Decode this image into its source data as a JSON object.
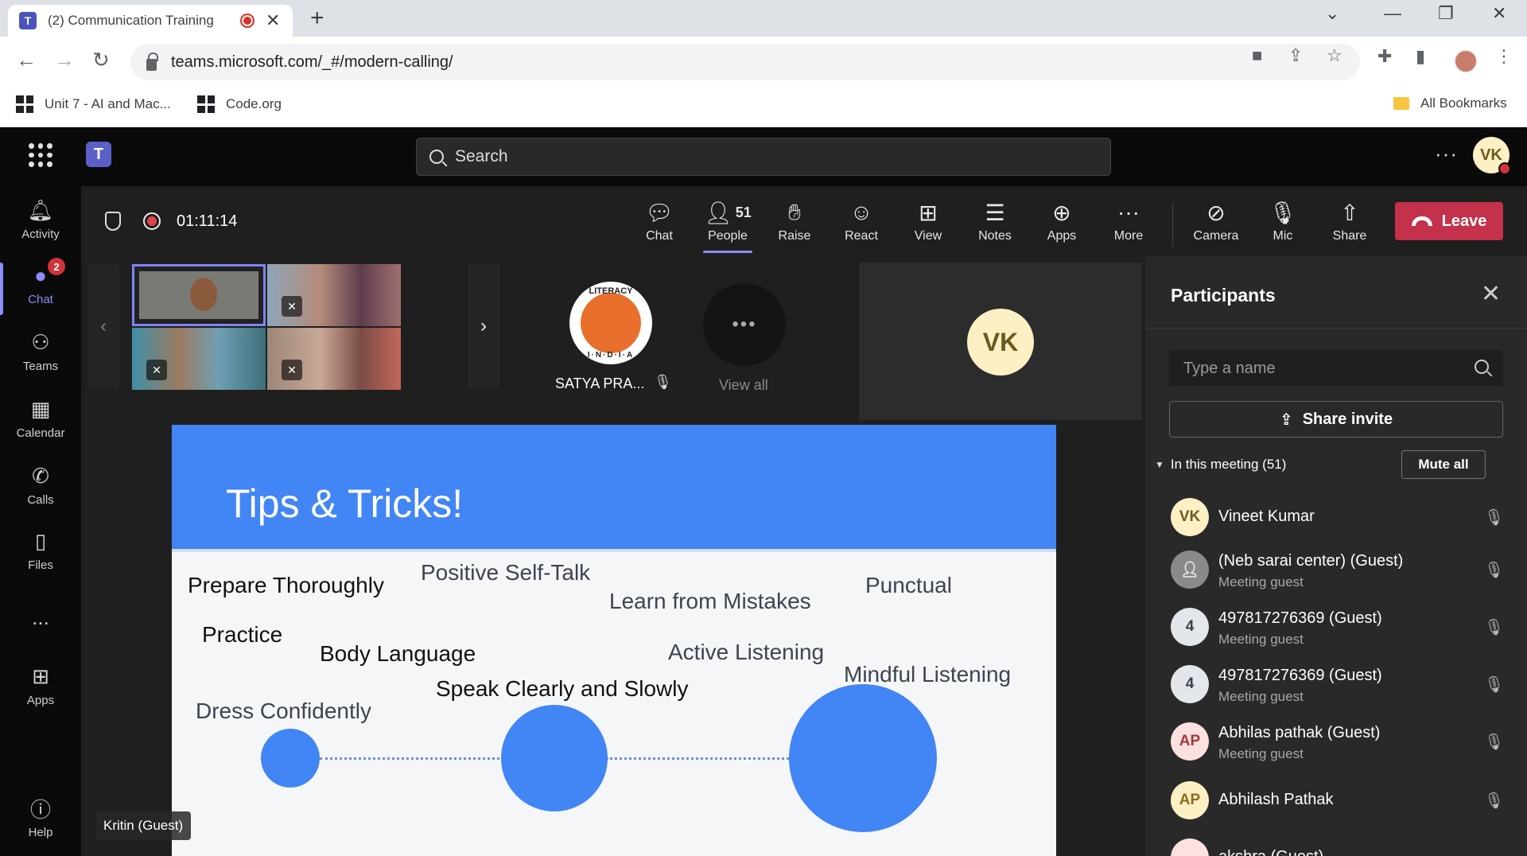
{
  "browser": {
    "tab_title": "(2) Communication Training",
    "url": "teams.microsoft.com/_#/modern-calling/",
    "bookmarks": [
      "Unit 7 - AI and Mac...",
      "Code.org"
    ],
    "all_bookmarks": "All Bookmarks"
  },
  "teams": {
    "search_placeholder": "Search",
    "me_initials": "VK"
  },
  "rail": [
    {
      "label": "Activity",
      "icon": "bell-icon"
    },
    {
      "label": "Chat",
      "icon": "chat-icon",
      "badge": "2",
      "active": true
    },
    {
      "label": "Teams",
      "icon": "teams-icon"
    },
    {
      "label": "Calendar",
      "icon": "calendar-icon"
    },
    {
      "label": "Calls",
      "icon": "phone-icon"
    },
    {
      "label": "Files",
      "icon": "file-icon"
    },
    {
      "label": "...",
      "icon": "more-icon"
    },
    {
      "label": "Apps",
      "icon": "apps-icon"
    },
    {
      "label": "Help",
      "icon": "help-icon"
    }
  ],
  "meeting": {
    "timer": "01:11:14",
    "toolbar": [
      {
        "label": "Chat",
        "icon": "chat-bubble-icon"
      },
      {
        "label": "People",
        "icon": "people-icon",
        "count": "51",
        "active": true
      },
      {
        "label": "Raise",
        "icon": "hand-icon"
      },
      {
        "label": "React",
        "icon": "smiley-icon"
      },
      {
        "label": "View",
        "icon": "grid-view-icon"
      },
      {
        "label": "Notes",
        "icon": "notes-icon"
      },
      {
        "label": "Apps",
        "icon": "add-app-icon"
      },
      {
        "label": "More",
        "icon": "more-icon"
      },
      {
        "label": "Camera",
        "icon": "camera-off-icon"
      },
      {
        "label": "Mic",
        "icon": "mic-off-icon"
      },
      {
        "label": "Share",
        "icon": "share-tray-icon"
      }
    ],
    "leave_label": "Leave",
    "gallery": {
      "satya_name": "SATYA PRA...",
      "satya_logo_top": "LITERACY",
      "satya_logo_bottom": "I·N·D·I·A",
      "view_all": "View all",
      "self_initials": "VK"
    },
    "name_chip": "Kritin (Guest)"
  },
  "slide": {
    "title": "Tips & Tricks!",
    "words": [
      "Prepare Thoroughly",
      "Positive Self-Talk",
      "Learn from Mistakes",
      "Punctual",
      "Practice",
      "Body Language",
      "Active Listening",
      "Mindful Listening",
      "Speak Clearly and Slowly",
      "Dress Confidently"
    ],
    "accent": "#4285f4"
  },
  "participants": {
    "title": "Participants",
    "search_placeholder": "Type a name",
    "share_invite": "Share invite",
    "section": "In this meeting (51)",
    "mute_all": "Mute all",
    "list": [
      {
        "initials": "VK",
        "name": "Vineet Kumar",
        "sub": ""
      },
      {
        "initials": "",
        "name": "(Neb sarai center) (Guest)",
        "sub": "Meeting guest"
      },
      {
        "initials": "4",
        "name": "497817276369 (Guest)",
        "sub": "Meeting guest"
      },
      {
        "initials": "4",
        "name": "497817276369 (Guest)",
        "sub": "Meeting guest"
      },
      {
        "initials": "AP",
        "name": "Abhilas pathak (Guest)",
        "sub": "Meeting guest"
      },
      {
        "initials": "AP",
        "name": "Abhilash Pathak",
        "sub": ""
      },
      {
        "initials": "",
        "name": "akshra (Guest)",
        "sub": ""
      }
    ]
  }
}
